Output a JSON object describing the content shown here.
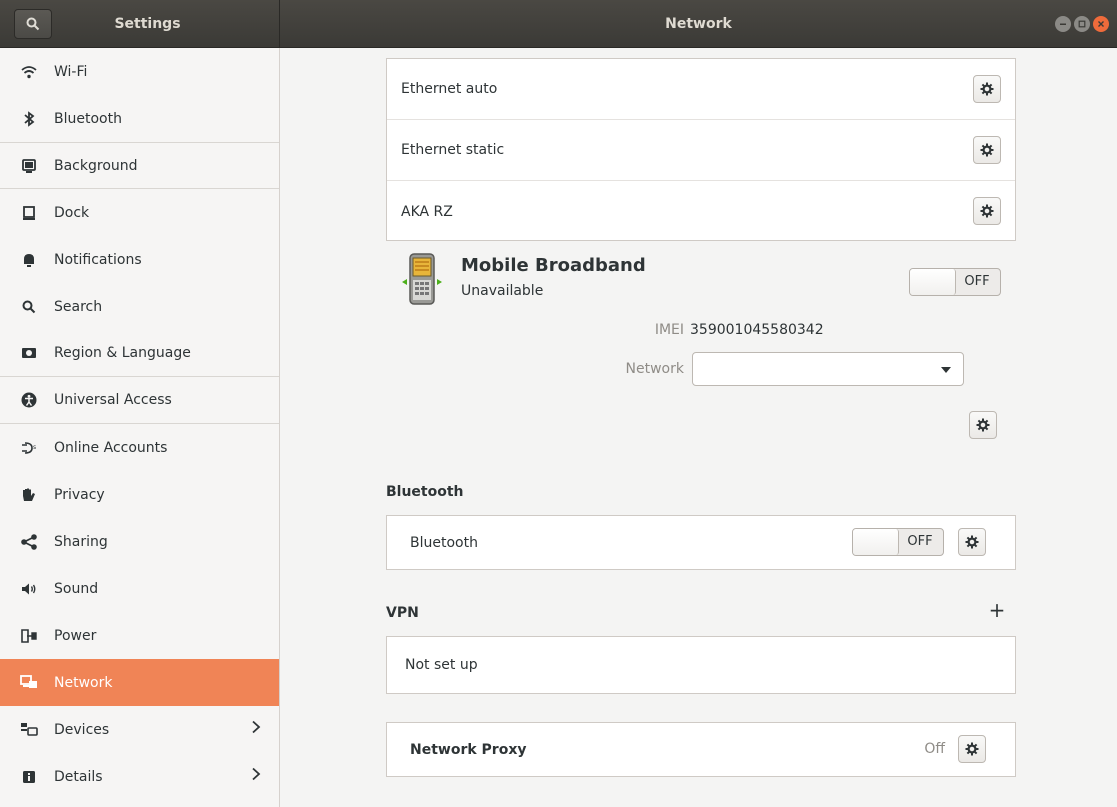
{
  "header": {
    "left_title": "Settings",
    "right_title": "Network"
  },
  "sidebar": {
    "items": [
      {
        "label": "Wi-Fi",
        "icon": "wifi-icon"
      },
      {
        "label": "Bluetooth",
        "icon": "bluetooth-icon"
      },
      {
        "label": "Background",
        "icon": "background-icon"
      },
      {
        "label": "Dock",
        "icon": "dock-icon"
      },
      {
        "label": "Notifications",
        "icon": "bell-icon"
      },
      {
        "label": "Search",
        "icon": "search-icon"
      },
      {
        "label": "Region & Language",
        "icon": "region-icon"
      },
      {
        "label": "Universal Access",
        "icon": "accessibility-icon"
      },
      {
        "label": "Online Accounts",
        "icon": "online-accounts-icon"
      },
      {
        "label": "Privacy",
        "icon": "hand-icon"
      },
      {
        "label": "Sharing",
        "icon": "share-icon"
      },
      {
        "label": "Sound",
        "icon": "speaker-icon"
      },
      {
        "label": "Power",
        "icon": "power-icon"
      },
      {
        "label": "Network",
        "icon": "network-icon"
      },
      {
        "label": "Devices",
        "icon": "devices-icon"
      },
      {
        "label": "Details",
        "icon": "info-icon"
      }
    ]
  },
  "wired": {
    "connections": [
      {
        "label": "Ethernet auto"
      },
      {
        "label": "Ethernet static"
      },
      {
        "label": "AKA RZ"
      }
    ]
  },
  "mobile": {
    "title": "Mobile Broadband",
    "status": "Unavailable",
    "switch_label": "OFF",
    "imei_label": "IMEI",
    "imei_value": "359001045580342",
    "network_label": "Network",
    "network_value": ""
  },
  "bluetooth": {
    "section_title": "Bluetooth",
    "row_label": "Bluetooth",
    "switch_label": "OFF"
  },
  "vpn": {
    "section_title": "VPN",
    "add_label": "+",
    "empty_label": "Not set up"
  },
  "proxy": {
    "label": "Network Proxy",
    "status": "Off"
  },
  "colors": {
    "accent": "#f08456",
    "titlebar": "#3b3a36",
    "close": "#ef6b3b"
  }
}
